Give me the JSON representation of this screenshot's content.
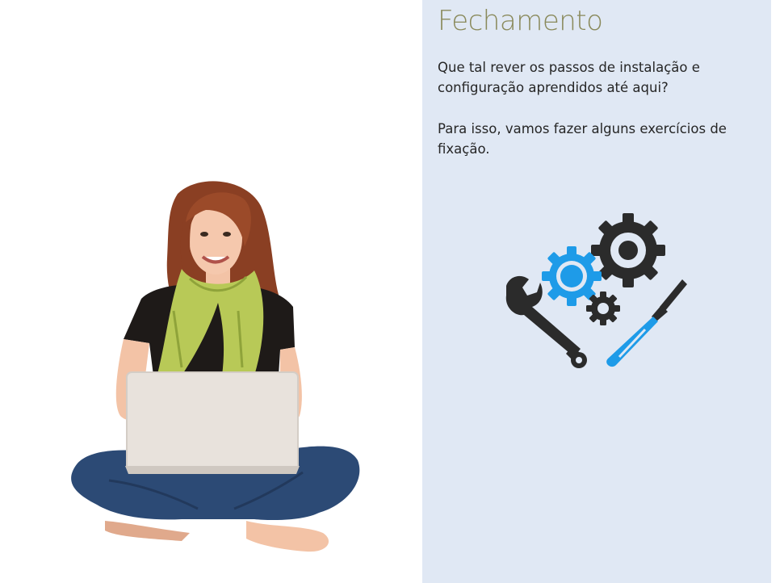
{
  "slide": {
    "title": "Fechamento",
    "paragraphs": [
      "Que tal rever os passos de instalação e configuração aprendidos até aqui?",
      "Para isso, vamos fazer alguns exercícios de fixação."
    ]
  },
  "illustrations": {
    "person": "woman-with-laptop-photo",
    "tools": "gears-wrench-screwdriver-icon"
  },
  "colors": {
    "panel_background": "#e0e8f4",
    "title": "#8a8a5c",
    "text": "#262626",
    "icon_dark": "#2b2b2b",
    "icon_blue": "#1e9be8"
  }
}
